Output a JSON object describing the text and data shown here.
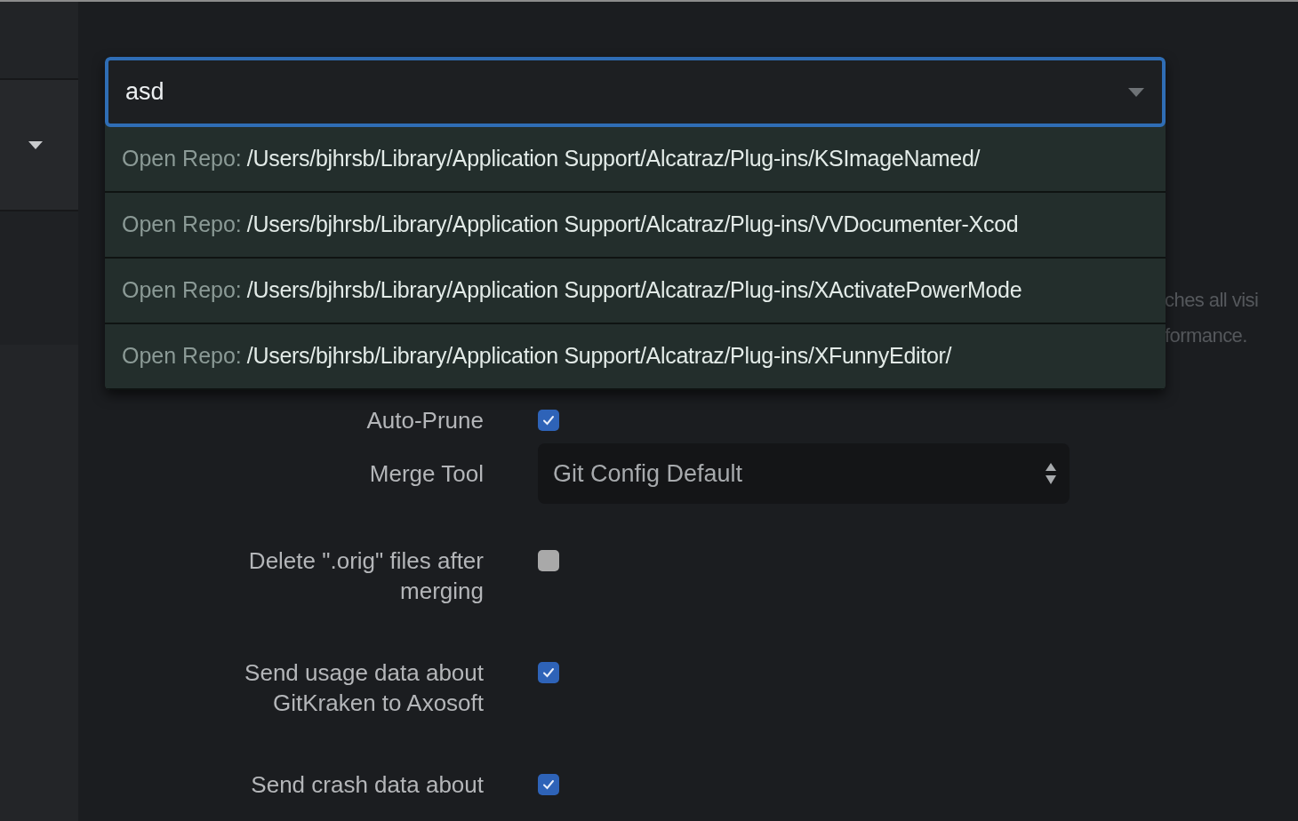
{
  "search": {
    "value": "asd"
  },
  "results": [
    {
      "prefix": "Open Repo:",
      "path": "/Users/bjhrsb/Library/Application Support/Alcatraz/Plug-ins/KSImageNamed/"
    },
    {
      "prefix": "Open Repo:",
      "path": "/Users/bjhrsb/Library/Application Support/Alcatraz/Plug-ins/VVDocumenter-Xcod"
    },
    {
      "prefix": "Open Repo:",
      "path": "/Users/bjhrsb/Library/Application Support/Alcatraz/Plug-ins/XActivatePowerMode"
    },
    {
      "prefix": "Open Repo:",
      "path": "/Users/bjhrsb/Library/Application Support/Alcatraz/Plug-ins/XFunnyEditor/"
    }
  ],
  "background_note": [
    "ches all visi",
    "formance."
  ],
  "settings": [
    {
      "kind": "checkbox",
      "label": "Auto-Prune",
      "checked": true
    },
    {
      "kind": "select",
      "label": "Merge Tool",
      "value": "Git Config Default"
    },
    {
      "kind": "checkbox",
      "label": "Delete \".orig\" files after merging",
      "checked": false
    },
    {
      "kind": "checkbox",
      "label": "Send usage data about GitKraken to Axosoft",
      "checked": true
    },
    {
      "kind": "checkbox",
      "label": "Send crash data about",
      "checked": true
    }
  ]
}
